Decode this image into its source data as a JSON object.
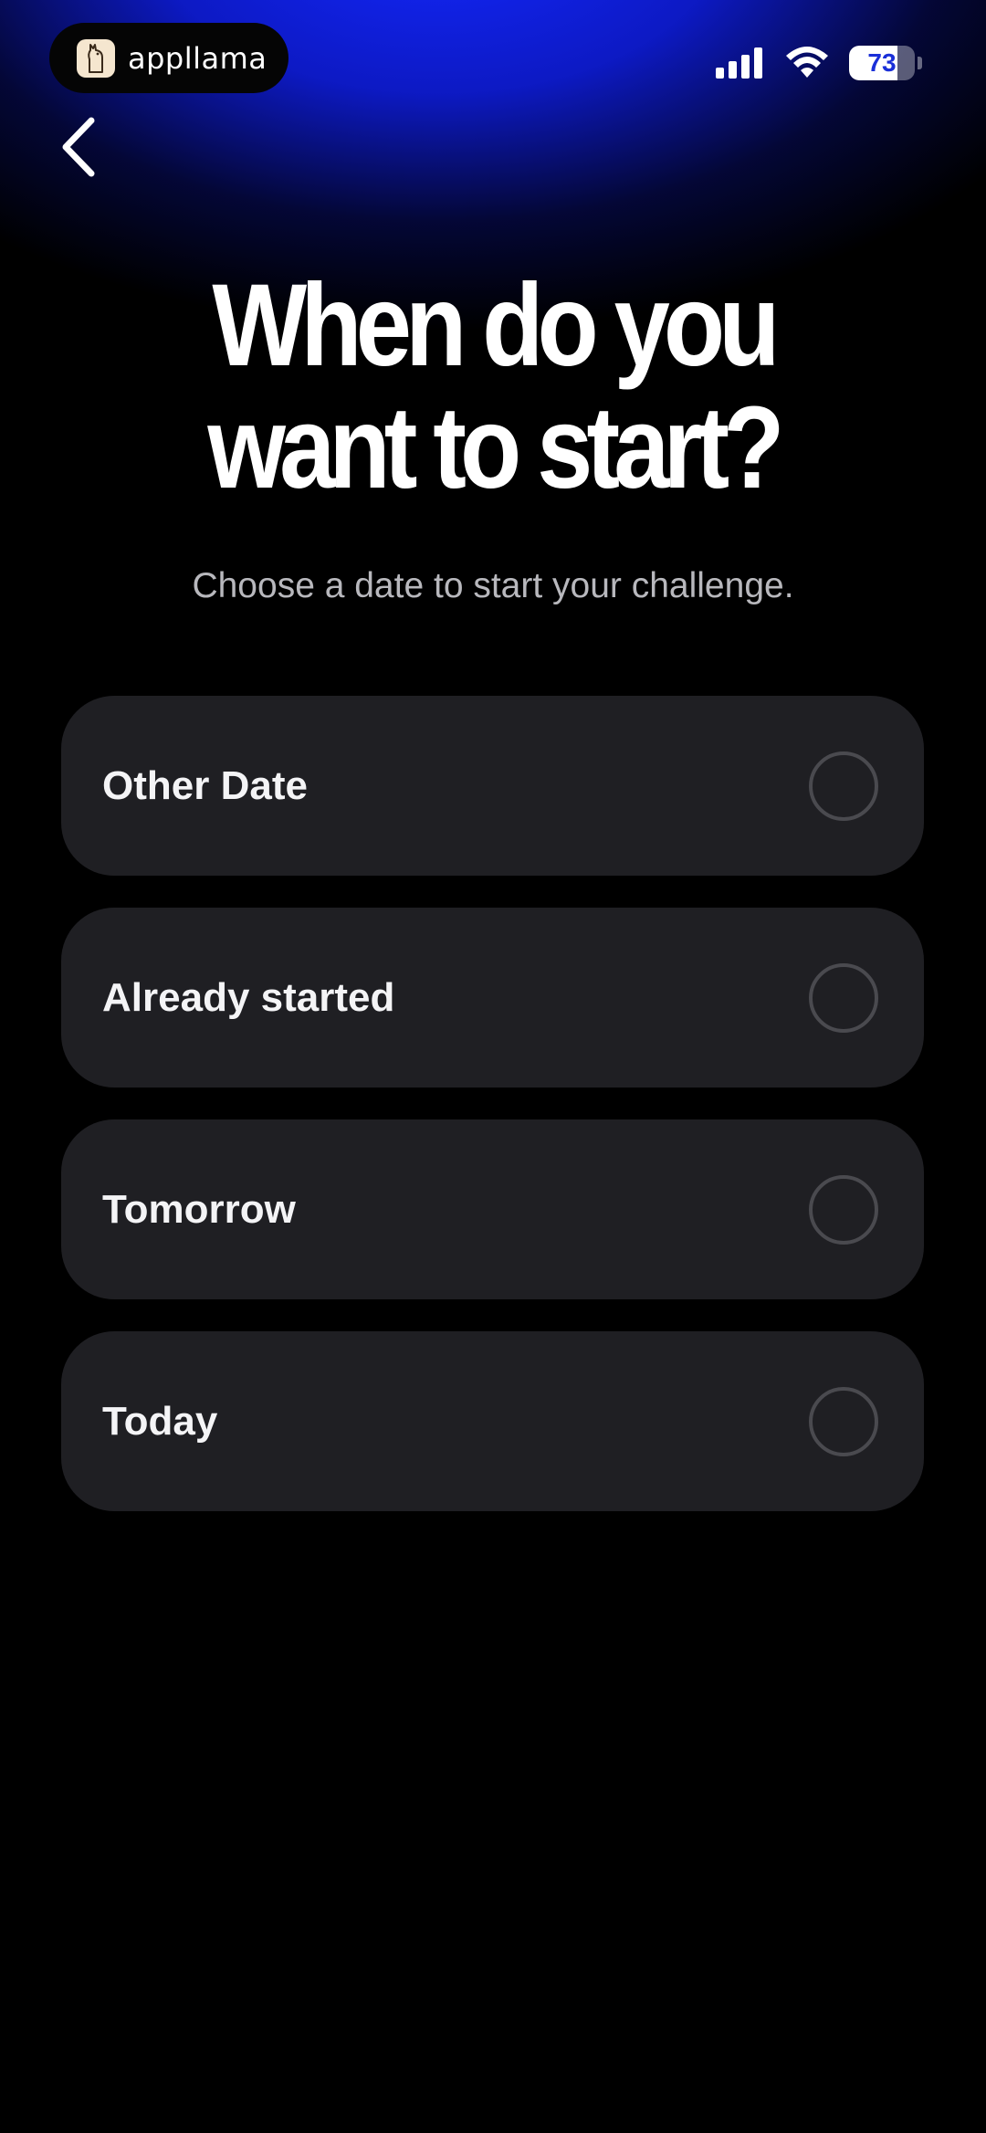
{
  "status_bar": {
    "app_pill_label": "appllama",
    "app_pill_icon": "llama-icon",
    "battery_percent": "73",
    "battery_level": 0.73,
    "signal_icon": "cellular-signal-icon",
    "wifi_icon": "wifi-icon"
  },
  "nav": {
    "back_icon": "chevron-left-icon"
  },
  "header": {
    "title_line1": "When do you",
    "title_line2": "want to start?",
    "subtitle": "Choose a date to start your challenge."
  },
  "options": [
    {
      "label": "Other Date",
      "selected": false
    },
    {
      "label": "Already started",
      "selected": false
    },
    {
      "label": "Tomorrow",
      "selected": false
    },
    {
      "label": "Today",
      "selected": false
    }
  ],
  "colors": {
    "background": "#000000",
    "accent_glow": "#1428ff",
    "card": "#1f1f23",
    "radio_border": "#4a4a4f",
    "subtitle": "#b8b8bd"
  }
}
